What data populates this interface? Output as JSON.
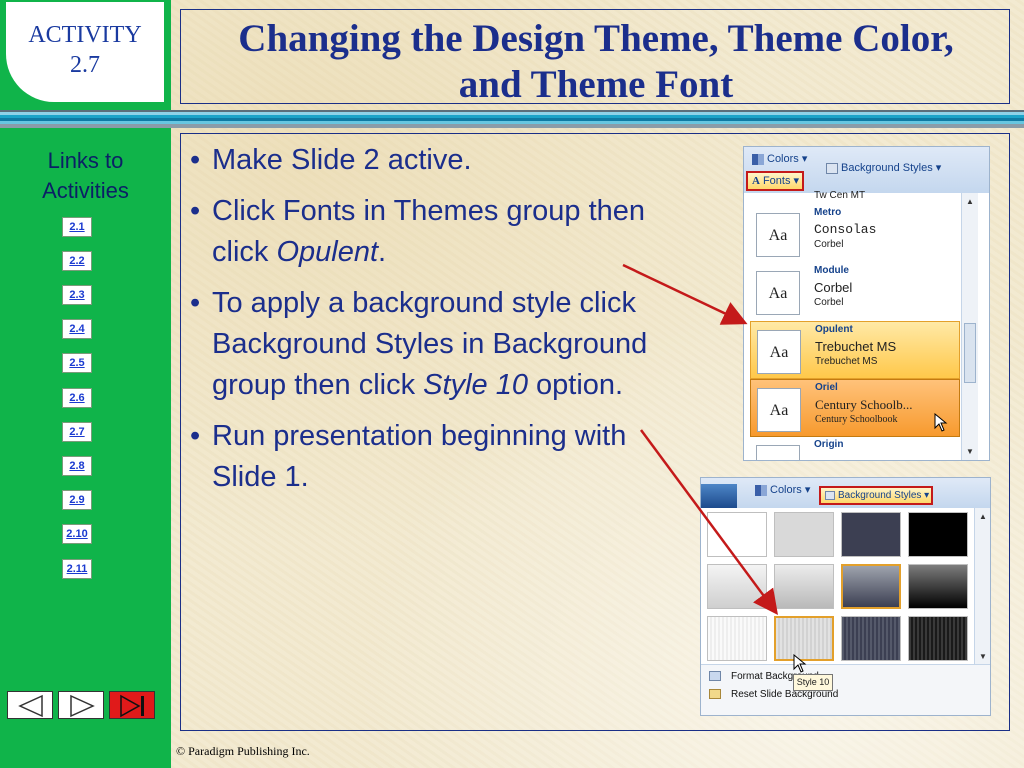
{
  "badge": {
    "line1": "ACTIVITY",
    "line2": "2.7"
  },
  "title": {
    "line1": "Changing the Design Theme, Theme Color,",
    "line2": "and Theme Font"
  },
  "sidebar": {
    "links_title_line1": "Links to",
    "links_title_line2": "Activities",
    "links": [
      "2.1",
      "2.2",
      "2.3",
      "2.4",
      "2.5",
      "2.6",
      "2.7",
      "2.8",
      "2.9",
      "2.10",
      "2.11"
    ]
  },
  "bullets": {
    "b1": "Make Slide 2 active.",
    "b2_pre": "Click Fonts in Themes group then click ",
    "b2_em": "Opulent",
    "b2_post": ".",
    "b3_pre": "To apply a background style click Background Styles in Background group then click ",
    "b3_em": "Style 10",
    "b3_post": " option.",
    "b4": "Run presentation beginning with Slide 1."
  },
  "footer": "© Paradigm Publishing Inc.",
  "shot1": {
    "colors_btn": "Colors",
    "fonts_btn": "Fonts",
    "bg_styles_btn": "Background Styles",
    "top_cut": "Tw Cen MT",
    "fonts": [
      {
        "name": "Metro",
        "heading": "Consolas",
        "body": "Corbel"
      },
      {
        "name": "Module",
        "heading": "Corbel",
        "body": "Corbel"
      },
      {
        "name": "Opulent",
        "heading": "Trebuchet MS",
        "body": "Trebuchet MS"
      },
      {
        "name": "Oriel",
        "heading": "Century Schoolb...",
        "body": "Century Schoolbook"
      },
      {
        "name": "Origin",
        "heading": "",
        "body": ""
      }
    ],
    "aa": "Aa"
  },
  "shot2": {
    "colors_btn": "Colors",
    "bg_styles_btn": "Background Styles",
    "format_bg": "Format Background...",
    "reset_bg": "Reset Slide Background",
    "tooltip": "Style 10"
  },
  "colors": {
    "sidebar": "#10b44a",
    "title": "#1b2e8c",
    "highlight": "#c41a1a"
  }
}
